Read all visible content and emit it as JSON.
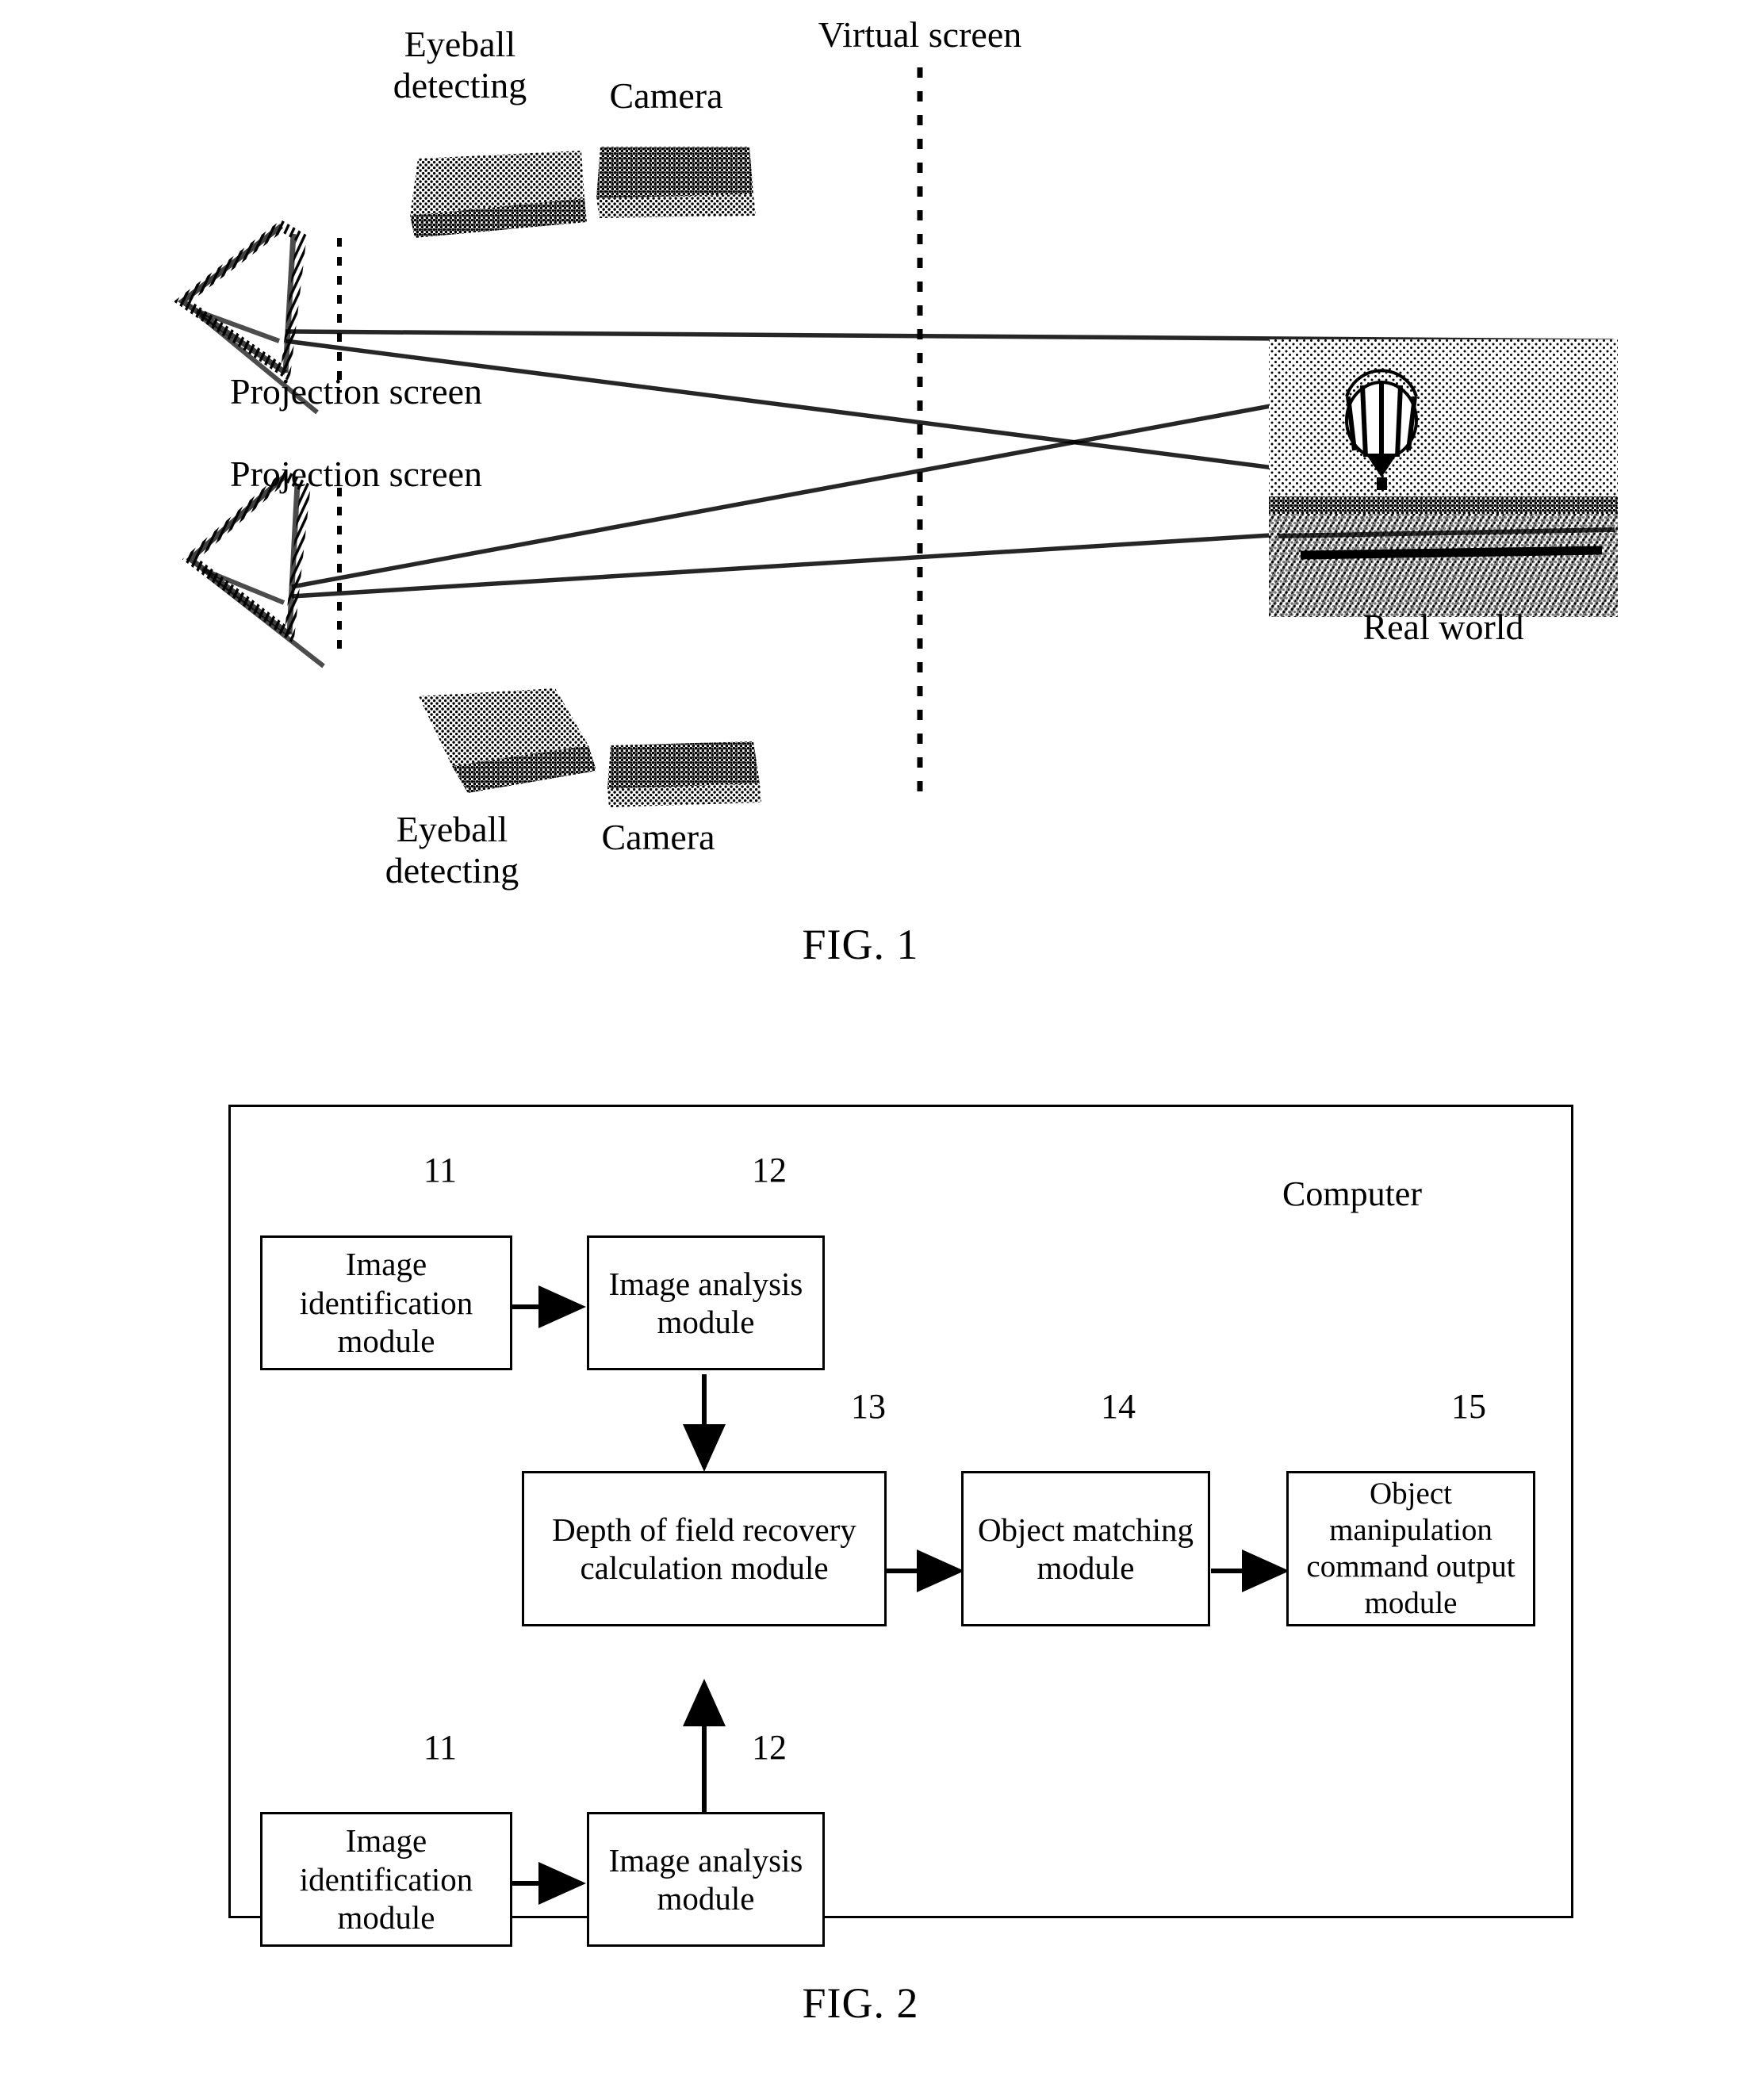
{
  "figure1": {
    "caption": "FIG. 1",
    "labels": {
      "eyeball_detecting_top": "Eyeball\ndetecting",
      "camera_top": "Camera",
      "virtual_screen": "Virtual screen",
      "projection_screen_top": "Projection screen",
      "projection_screen_bottom": "Projection screen",
      "real_world": "Real world",
      "eyeball_detecting_bottom": "Eyeball\ndetecting",
      "camera_bottom": "Camera"
    },
    "scene": {
      "real_world_content": "hot-air-balloon-over-landscape",
      "virtual_screen_style": "vertical-dashed-line",
      "projection_screen_style": "vertical-dashed-line",
      "eye_style": "triangular-viewing-frustum"
    }
  },
  "figure2": {
    "caption": "FIG. 2",
    "container_label": "Computer",
    "modules": [
      {
        "id": "top-identification",
        "ref": "11",
        "label": "Image\nidentification\nmodule"
      },
      {
        "id": "top-analysis",
        "ref": "12",
        "label": "Image\nanalysis\nmodule"
      },
      {
        "id": "depth-recovery",
        "ref": "13",
        "label": "Depth of field\nrecovery calculation\nmodule"
      },
      {
        "id": "object-matching",
        "ref": "14",
        "label": "Object\nmatching\nmodule"
      },
      {
        "id": "command-output",
        "ref": "15",
        "label": "Object\nmanipulation\ncommand\noutput module"
      },
      {
        "id": "bottom-identification",
        "ref": "11",
        "label": "Image\nidentification\nmodule"
      },
      {
        "id": "bottom-analysis",
        "ref": "12",
        "label": "Image\nanalysis\nmodule"
      }
    ],
    "connections": [
      {
        "from": "top-identification",
        "to": "top-analysis",
        "direction": "right"
      },
      {
        "from": "top-analysis",
        "to": "depth-recovery",
        "direction": "down"
      },
      {
        "from": "depth-recovery",
        "to": "object-matching",
        "direction": "right"
      },
      {
        "from": "object-matching",
        "to": "command-output",
        "direction": "right"
      },
      {
        "from": "bottom-identification",
        "to": "bottom-analysis",
        "direction": "right"
      },
      {
        "from": "bottom-analysis",
        "to": "depth-recovery",
        "direction": "up"
      }
    ]
  },
  "colors": {
    "ink": "#000000",
    "paper": "#ffffff"
  }
}
